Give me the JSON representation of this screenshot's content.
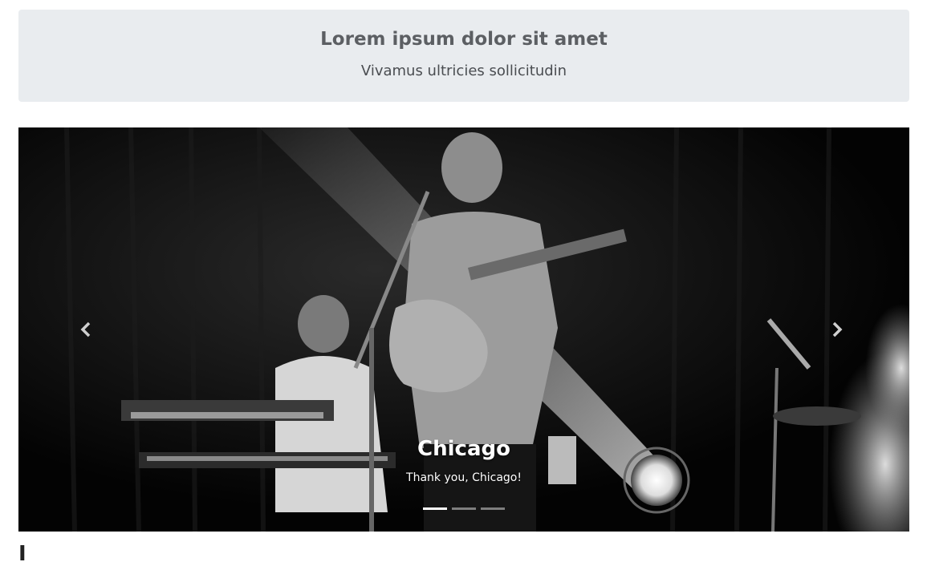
{
  "jumbotron": {
    "title": "Lorem ipsum dolor sit amet",
    "subtitle": "Vivamus ultricies sollicitudin"
  },
  "carousel": {
    "active_index": 0,
    "slides": [
      {
        "title": "Chicago",
        "caption": "Thank you, Chicago!"
      }
    ],
    "indicator_count": 3,
    "prev_icon": "chevron-left-icon",
    "next_icon": "chevron-right-icon"
  },
  "section": {
    "heading_fragment": "I"
  },
  "colors": {
    "jumbotron_bg": "#e9ecef",
    "carousel_bg": "#050505",
    "indicator_active": "#ffffff"
  }
}
